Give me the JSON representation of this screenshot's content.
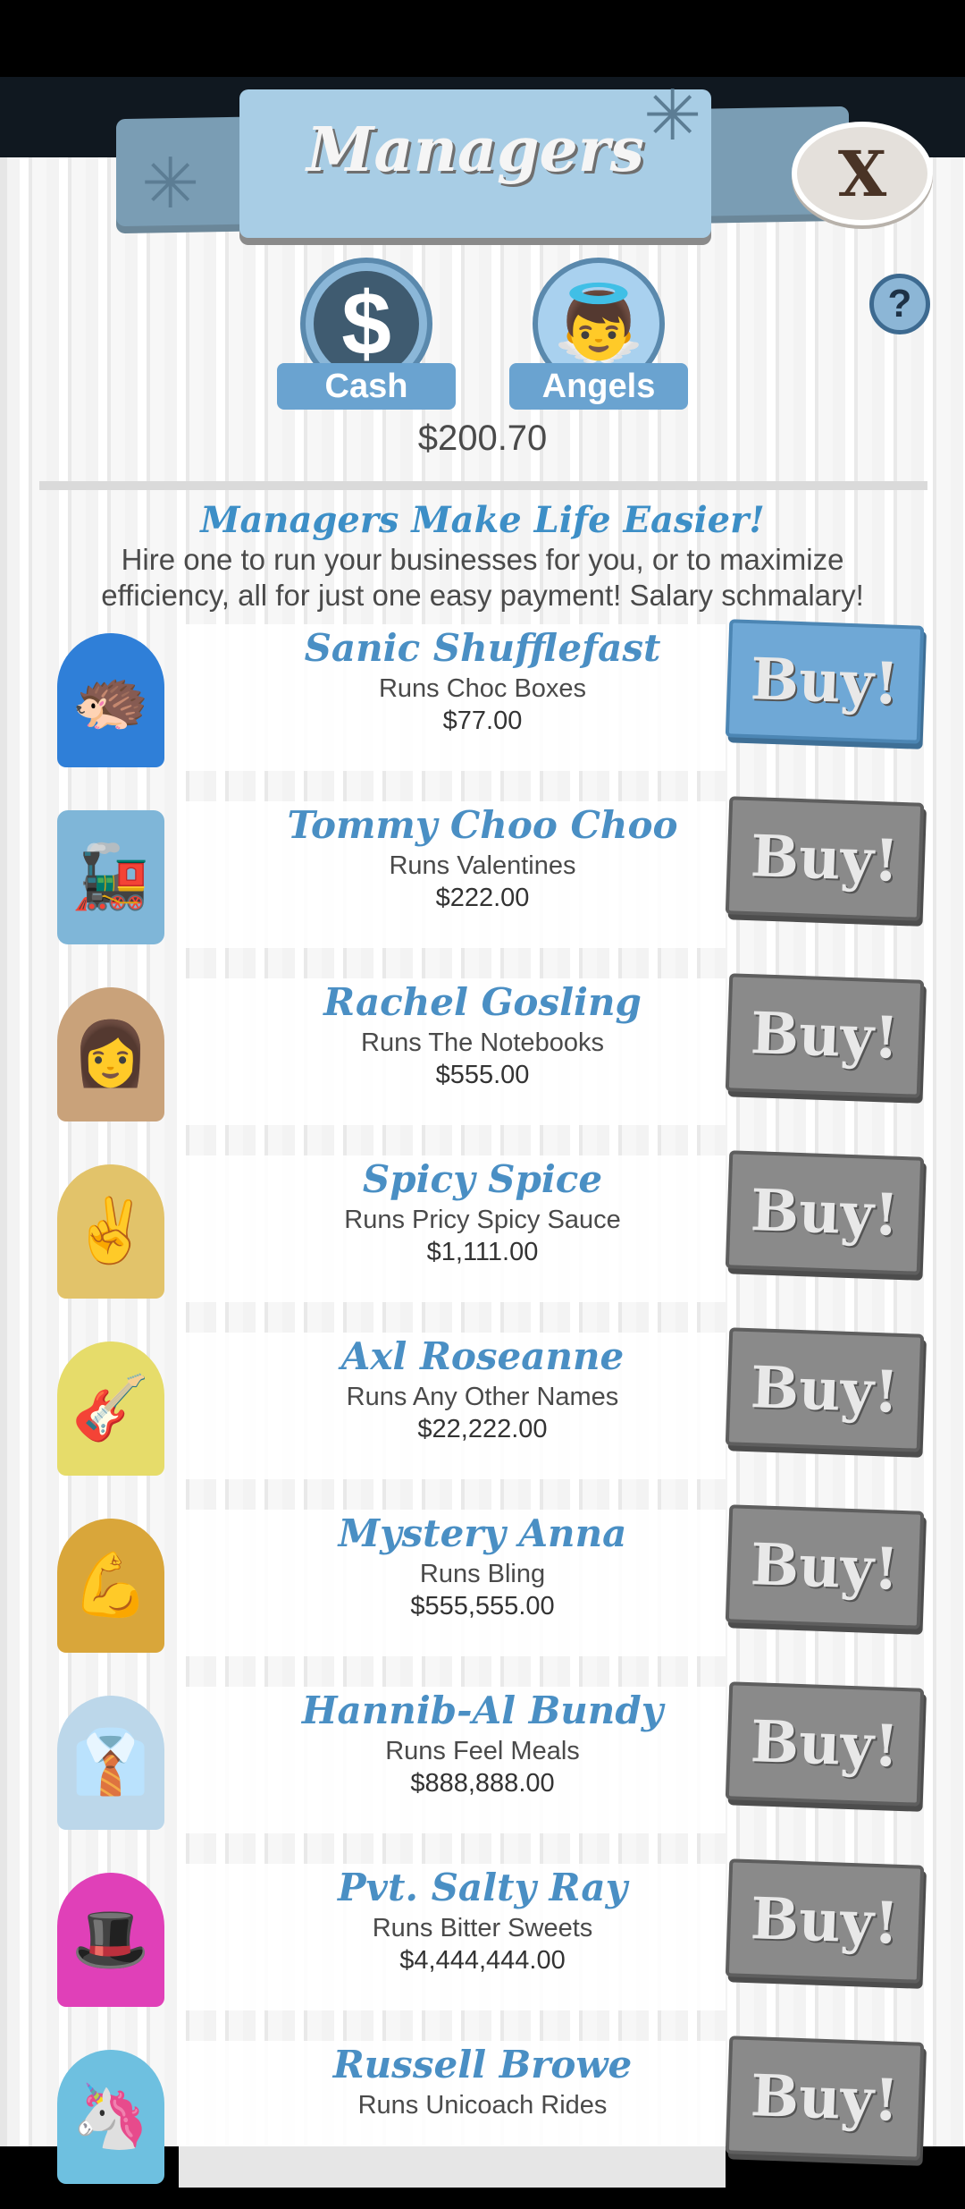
{
  "header": {
    "title": "Managers",
    "close_label": "X",
    "help_label": "?"
  },
  "tabs": {
    "cash_label": "Cash",
    "cash_symbol": "$",
    "angels_label": "Angels"
  },
  "balance": "$200.70",
  "intro": {
    "title": "Managers Make Life Easier!",
    "text": "Hire one to run your businesses for you, or to maximize efficiency, all for just one easy payment! Salary schmalary!"
  },
  "managers": [
    {
      "name": "Sanic Shufflefast",
      "business": "Runs Choc Boxes",
      "price": "$77.00",
      "buy_label": "Buy!",
      "affordable": true
    },
    {
      "name": "Tommy Choo Choo",
      "business": "Runs Valentines",
      "price": "$222.00",
      "buy_label": "Buy!",
      "affordable": false
    },
    {
      "name": "Rachel Gosling",
      "business": "Runs The Notebooks",
      "price": "$555.00",
      "buy_label": "Buy!",
      "affordable": false
    },
    {
      "name": "Spicy Spice",
      "business": "Runs Pricy Spicy Sauce",
      "price": "$1,111.00",
      "buy_label": "Buy!",
      "affordable": false
    },
    {
      "name": "Axl Roseanne",
      "business": "Runs Any Other Names",
      "price": "$22,222.00",
      "buy_label": "Buy!",
      "affordable": false
    },
    {
      "name": "Mystery Anna",
      "business": "Runs Bling",
      "price": "$555,555.00",
      "buy_label": "Buy!",
      "affordable": false
    },
    {
      "name": "Hannib-Al Bundy",
      "business": "Runs Feel Meals",
      "price": "$888,888.00",
      "buy_label": "Buy!",
      "affordable": false
    },
    {
      "name": "Pvt. Salty Ray",
      "business": "Runs Bitter Sweets",
      "price": "$4,444,444.00",
      "buy_label": "Buy!",
      "affordable": false
    },
    {
      "name": "Russell Browe",
      "business": "Runs Unicoach Rides",
      "price": "",
      "buy_label": "Buy!",
      "affordable": false
    }
  ],
  "colors": {
    "accent_blue": "#4a8fc4",
    "buy_active": "#6fa8d6",
    "buy_inactive": "#8a8a8a"
  }
}
